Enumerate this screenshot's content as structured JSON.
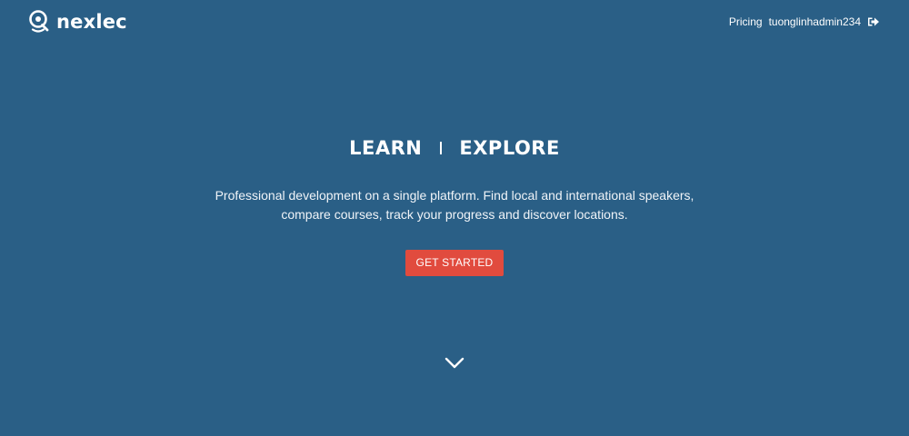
{
  "header": {
    "brand": "nexlec",
    "nav": {
      "pricing": "Pricing",
      "username": "tuonglinhadmin234"
    },
    "logout_icon": "sign-out-icon"
  },
  "hero": {
    "title_left": "LEARN",
    "title_right": "EXPLORE",
    "description_line1": "Professional development on a single platform. Find local and international speakers,",
    "description_line2": "compare courses, track your progress and discover locations.",
    "cta_label": "GET STARTED",
    "scroll_icon": "chevron-down-icon"
  },
  "colors": {
    "background": "#2a5f86",
    "cta": "#e14b3e",
    "text": "#ffffff"
  }
}
